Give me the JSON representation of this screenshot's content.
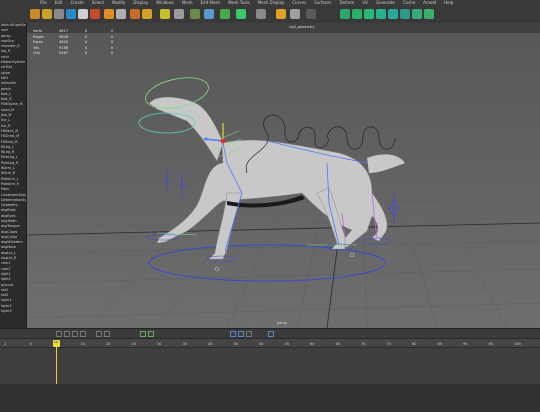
{
  "menu": [
    "File",
    "Edit",
    "Create",
    "Select",
    "Modify",
    "Display",
    "Windows",
    "Mesh",
    "Edit Mesh",
    "Mesh Tools",
    "Mesh Display",
    "Curves",
    "Surfaces",
    "Deform",
    "UV",
    "Generate",
    "Cache",
    "Arnold",
    "Help"
  ],
  "workspace_label": "rig4_geometry",
  "hud": {
    "rows": [
      {
        "label": "Verts",
        "a": "4617",
        "b": "0",
        "c": "0"
      },
      {
        "label": "Edges",
        "a": "9626",
        "b": "0",
        "c": "0"
      },
      {
        "label": "Faces",
        "a": "4620",
        "b": "0",
        "c": "0"
      },
      {
        "label": "Tris",
        "a": "9198",
        "b": "0",
        "c": "0"
      },
      {
        "label": "UVs",
        "a": "5467",
        "b": "0",
        "c": "0"
      }
    ]
  },
  "outliner_items": [
    "defaultLightSet",
    "root",
    "persp",
    "rootGrp",
    "shoulder_R",
    "leg_R",
    "neck",
    "MotionSystem",
    "ctrlSet",
    "spine",
    "tail1",
    "ikHandle",
    "pelvis",
    "foot_L",
    "foot_R",
    "FKIKSpine_M",
    "head_M",
    "Jaw_M",
    "Ear_L",
    "Ear_R",
    "FKNeck_M",
    "FKChest_M",
    "FKRoot_M",
    "IKLeg_L",
    "IKLeg_R",
    "PoleLeg_L",
    "PoleLeg_R",
    "IKArm_L",
    "IKArm_R",
    "PoleArm_L",
    "PoleArm_R",
    "Main",
    "ConstraintSystem",
    "DeformationSystem",
    "Geometry",
    "dogBody",
    "dogEyes",
    "dogTeeth",
    "dogTongue",
    "dogClaws",
    "dogCollar",
    "dogWhiskers",
    "dogNose",
    "dogLid_L",
    "dogLid_R",
    "cam1",
    "cam2",
    "light1",
    "light2",
    "ground",
    "set1",
    "set2",
    "layer1",
    "layer2",
    "layer3"
  ],
  "camera_label": "persp",
  "timeline": {
    "ticks": [
      "1",
      "5",
      "10",
      "15",
      "20",
      "25",
      "30",
      "35",
      "40",
      "45",
      "50",
      "55",
      "60",
      "65",
      "70",
      "75",
      "80",
      "85",
      "90",
      "95",
      "100"
    ],
    "current_frame": "10"
  },
  "colors": {
    "accent": "#f1dc3c",
    "rig_blue": "#4a78ff",
    "rig_green": "#7fe07f"
  }
}
